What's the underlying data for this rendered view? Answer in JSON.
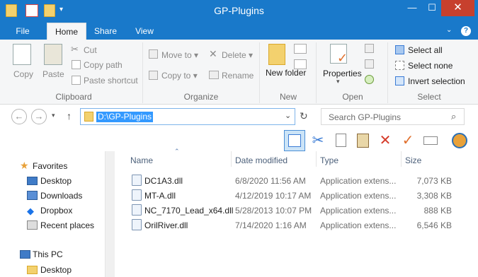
{
  "window": {
    "title": "GP-Plugins",
    "minimize": "—",
    "maximize": "☐",
    "close": "✕"
  },
  "ribbon_tabs": [
    "File",
    "Home",
    "Share",
    "View"
  ],
  "ribbon": {
    "clipboard": {
      "label": "Clipboard",
      "copy": "Copy",
      "paste": "Paste",
      "cut": "Cut",
      "copy_path": "Copy path",
      "paste_shortcut": "Paste shortcut"
    },
    "organize": {
      "label": "Organize",
      "move_to": "Move to",
      "copy_to": "Copy to",
      "delete": "Delete",
      "rename": "Rename"
    },
    "new": {
      "label": "New",
      "new_folder": "New folder"
    },
    "open": {
      "label": "Open",
      "properties": "Properties"
    },
    "select": {
      "label": "Select",
      "select_all": "Select all",
      "select_none": "Select none",
      "invert_selection": "Invert selection"
    }
  },
  "address": {
    "path": "D:\\GP-Plugins",
    "search_placeholder": "Search GP-Plugins"
  },
  "columns": {
    "name": "Name",
    "date_modified": "Date modified",
    "type": "Type",
    "size": "Size"
  },
  "files": [
    {
      "name": "DC1A3.dll",
      "date": "6/8/2020 11:56 AM",
      "type": "Application extens...",
      "size": "7,073 KB"
    },
    {
      "name": "MT-A.dll",
      "date": "4/12/2019 10:17 AM",
      "type": "Application extens...",
      "size": "3,308 KB"
    },
    {
      "name": "NC_7170_Lead_x64.dll",
      "date": "5/28/2013 10:07 PM",
      "type": "Application extens...",
      "size": "888 KB"
    },
    {
      "name": "OrilRiver.dll",
      "date": "7/14/2020 1:16 AM",
      "type": "Application extens...",
      "size": "6,546 KB"
    }
  ],
  "sidebar": {
    "favorites": "Favorites",
    "items": [
      "Desktop",
      "Downloads",
      "Dropbox",
      "Recent places"
    ],
    "this_pc": "This PC",
    "pc_items": [
      "Desktop"
    ]
  }
}
